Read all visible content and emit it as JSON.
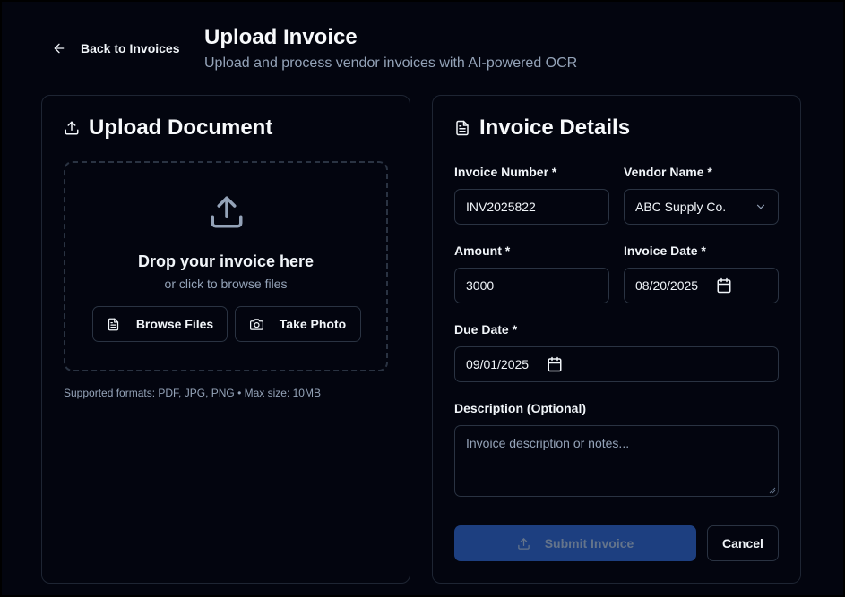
{
  "header": {
    "back_label": "Back to Invoices",
    "title": "Upload Invoice",
    "subtitle": "Upload and process vendor invoices with AI-powered OCR"
  },
  "upload": {
    "title": "Upload Document",
    "drop_title": "Drop your invoice here",
    "drop_subtitle": "or click to browse files",
    "browse_label": "Browse Files",
    "photo_label": "Take Photo",
    "formats": "Supported formats: PDF, JPG, PNG • Max size: 10MB"
  },
  "details": {
    "title": "Invoice Details",
    "invoice_number_label": "Invoice Number *",
    "invoice_number_value": "INV2025822",
    "vendor_label": "Vendor Name *",
    "vendor_value": "ABC Supply Co.",
    "amount_label": "Amount *",
    "amount_value": "3000",
    "invoice_date_label": "Invoice Date *",
    "invoice_date_value": "08/20/2025",
    "due_date_label": "Due Date *",
    "due_date_value": "09/01/2025",
    "description_label": "Description (Optional)",
    "description_placeholder": "Invoice description or notes...",
    "submit_label": "Submit Invoice",
    "cancel_label": "Cancel"
  },
  "icons": {
    "back": "arrow-left-icon",
    "upload": "upload-icon",
    "document": "file-text-icon",
    "camera": "camera-icon",
    "chevron": "chevron-down-icon",
    "calendar": "calendar-icon"
  },
  "colors": {
    "background": "#03050f",
    "border": "#2a3342",
    "submit_bg": "#1d3f80",
    "muted_text": "#94a3b8"
  }
}
